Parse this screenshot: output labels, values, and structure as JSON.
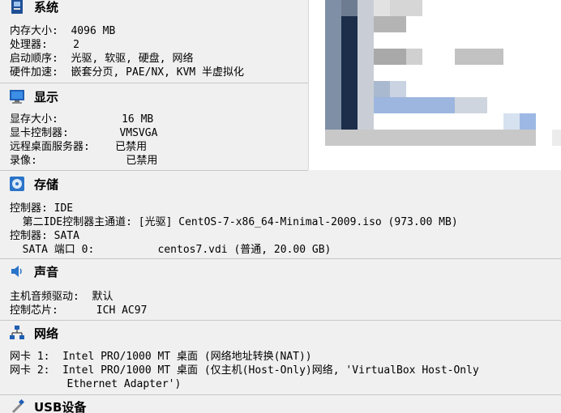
{
  "system": {
    "title": "系统",
    "icon": "motherboard-icon",
    "lines": [
      "内存大小:  4096 MB",
      "处理器:    2",
      "启动顺序:  光驱, 软驱, 硬盘, 网络",
      "硬件加速:  嵌套分页, PAE/NX, KVM 半虚拟化"
    ]
  },
  "display": {
    "title": "显示",
    "icon": "monitor-icon",
    "lines": [
      "显存大小:          16 MB",
      "显卡控制器:        VMSVGA",
      "远程桌面服务器:    已禁用",
      "录像:              已禁用"
    ]
  },
  "storage": {
    "title": "存储",
    "icon": "storage-disk-icon",
    "lines": [
      "控制器: IDE",
      "  第二IDE控制器主通道: [光驱] CentOS-7-x86_64-Minimal-2009.iso (973.00 MB)",
      "控制器: SATA",
      "  SATA 端口 0:          centos7.vdi (普通, 20.00 GB)"
    ]
  },
  "audio": {
    "title": "声音",
    "icon": "speaker-icon",
    "lines": [
      "主机音频驱动:  默认",
      "控制芯片:      ICH AC97"
    ]
  },
  "network": {
    "title": "网络",
    "icon": "network-icon",
    "lines": [
      "网卡 1:  Intel PRO/1000 MT 桌面 (网络地址转换(NAT))",
      "网卡 2:  Intel PRO/1000 MT 桌面 (仅主机(Host-Only)网络, 'VirtualBox Host-Only",
      "         Ethernet Adapter')"
    ]
  },
  "usb": {
    "title": "USB设备",
    "icon": "usb-icon"
  },
  "colors": {
    "accent_blue": "#1f5fb4",
    "header_bg": "#f0f0f0",
    "divider": "#c8c8c8"
  }
}
